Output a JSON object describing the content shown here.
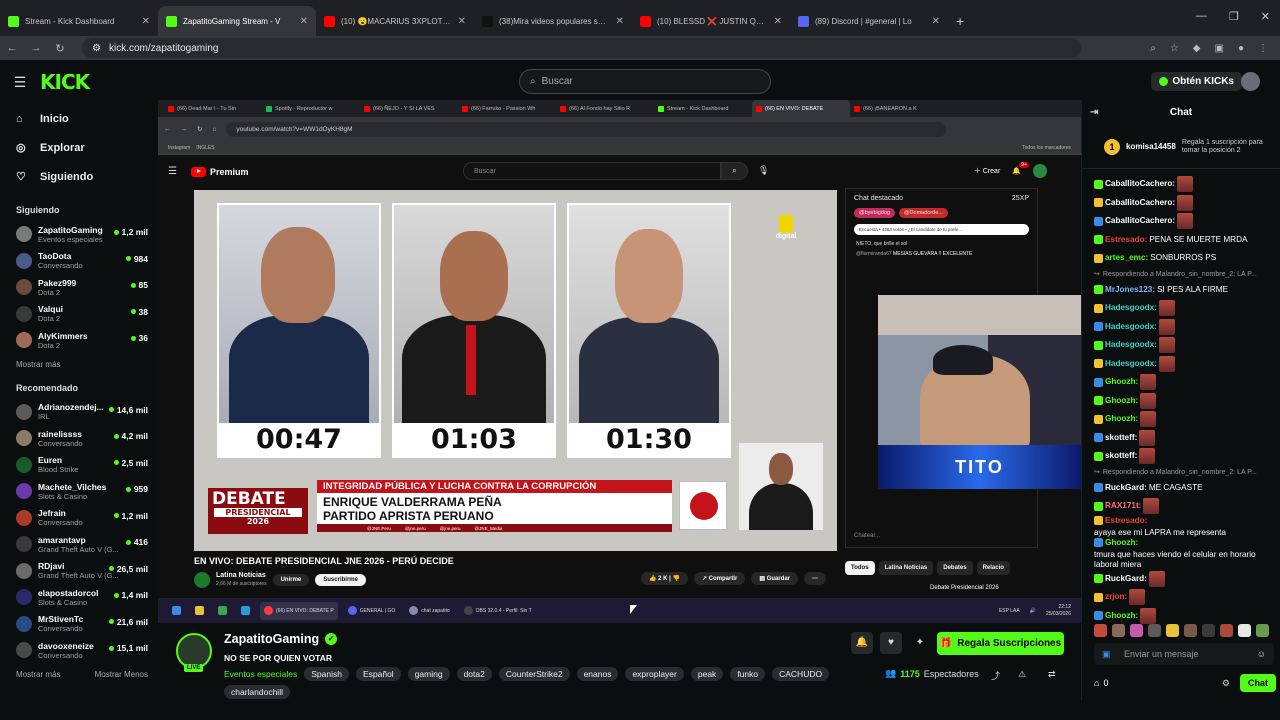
{
  "browser": {
    "tabs": [
      {
        "label": "Stream - Kick Dashboard",
        "color": "#53fc18",
        "active": false
      },
      {
        "label": "ZapatitoGaming Stream - V",
        "color": "#53fc18",
        "active": true
      },
      {
        "label": "(10) 😮MACARIUS 3XPLOTÓ y P",
        "color": "#ff0000",
        "active": false
      },
      {
        "label": "(38)Mira videos populares selec",
        "color": "#111111",
        "active": false
      },
      {
        "label": "(10) BLESSD ❌ JUSTIN QUILES",
        "color": "#ff0000",
        "active": false
      },
      {
        "label": "(89) Discord | #general | Lo",
        "color": "#5865f2",
        "active": false
      }
    ],
    "url": "kick.com/zapatitogaming"
  },
  "kick": {
    "logo": "KICK",
    "search_placeholder": "Buscar",
    "kicks_button": "Obtén KICKs"
  },
  "sidebar": {
    "nav": [
      {
        "label": "Inicio",
        "icon": "home-icon"
      },
      {
        "label": "Explorar",
        "icon": "compass-icon"
      },
      {
        "label": "Siguiendo",
        "icon": "heart-icon"
      }
    ],
    "following_title": "Siguiendo",
    "following": [
      {
        "name": "ZapatitoGaming",
        "game": "Eventos especiales",
        "viewers": "1,2 mil",
        "color": "#7a7a7a"
      },
      {
        "name": "TaoDota",
        "game": "Conversando",
        "viewers": "984",
        "color": "#4a5a8a"
      },
      {
        "name": "Pakez999",
        "game": "Dota 2",
        "viewers": "85",
        "color": "#6a4a3a"
      },
      {
        "name": "Valqui",
        "game": "Dota 2",
        "viewers": "38",
        "color": "#3a3a3a"
      },
      {
        "name": "AlyKimmers",
        "game": "Dota 2",
        "viewers": "36",
        "color": "#a06a5a"
      }
    ],
    "show_more": "Mostrar más",
    "recommended_title": "Recomendado",
    "recommended": [
      {
        "name": "Adrianozendej...",
        "game": "IRL",
        "viewers": "14,6 mil",
        "color": "#5a5a5a"
      },
      {
        "name": "rainelissss",
        "game": "Conversando",
        "viewers": "4,2 mil",
        "color": "#8a7a6a"
      },
      {
        "name": "Euren",
        "game": "Blood Strike",
        "viewers": "2,5 mil",
        "color": "#1a5a2a"
      },
      {
        "name": "Machete_Vilches",
        "game": "Slots & Casino",
        "viewers": "959",
        "color": "#6a3aaa"
      },
      {
        "name": "Jefrain",
        "game": "Conversando",
        "viewers": "1,2 mil",
        "color": "#aa3a2a"
      },
      {
        "name": "amarantavp",
        "game": "Grand Theft Auto V (G...",
        "viewers": "416",
        "color": "#3a3a3a"
      },
      {
        "name": "RDjavi",
        "game": "Grand Theft Auto V (G...",
        "viewers": "26,5 mil",
        "color": "#6a6a6a"
      },
      {
        "name": "elapostadorcol",
        "game": "Slots & Casino",
        "viewers": "1,4 mil",
        "color": "#2a2a6a"
      },
      {
        "name": "MrStivenTc",
        "game": "Conversando",
        "viewers": "21,6 mil",
        "color": "#2a4a8a"
      },
      {
        "name": "davooxeneize",
        "game": "Conversando",
        "viewers": "15,1 mil",
        "color": "#4a4a4a"
      }
    ],
    "show_more2": "Mostrar más",
    "show_less": "Mostrar Menos"
  },
  "inner_browser": {
    "tabs": [
      "(66) Dead Mar I - Tu Sin",
      "Spotify - Reproductor w",
      "(66) ÑEJO - Y SI LA VES",
      "(66) Farruko - Passion Wh",
      "(66) Al Fondo hay Sitio R",
      "Stream - Kick Dashboard",
      "(66) EN VIVO: DEBATE",
      "(66) ¡BANEARON a K"
    ],
    "url": "youtube.com/watch?v=WW1dOyKH8gM",
    "bookmarks": [
      "Instagram",
      "INGLES"
    ],
    "bookmarks_right": "Todos los marcadores"
  },
  "youtube": {
    "logo": "Premium",
    "search_placeholder": "Buscar",
    "create": "Crear",
    "notif_count": "9+",
    "timers": [
      "00:47",
      "01:03",
      "01:30"
    ],
    "digital": "digital",
    "debate_top": "DEBATE",
    "debate_sub": "PRESIDENCIAL",
    "debate_year": "2026",
    "lower_third_red": "INTEGRIDAD PÚBLICA Y LUCHA CONTRA LA CORRUPCIÓN",
    "lower_third_name": "ENRIQUE VALDERRAMA PEÑA",
    "lower_third_party": "PARTIDO APRISTA PERUANO",
    "handles": [
      "@JNE.Peru",
      "@jne.peru",
      "@jne.peru",
      "@JNE_Media"
    ],
    "video_title": "EN VIVO: DEBATE PRESIDENCIAL JNE 2026 - PERÚ DECIDE",
    "channel": "Latina Noticias",
    "subs": "2,66 M de suscriptores",
    "join": "Unirme",
    "subscribe": "Suscribirme",
    "likes": "2 K",
    "share": "Compartir",
    "save": "Guardar",
    "chat_title": "Chat destacado",
    "chat_poll": "Encuesta • 4353 votos • ¿El candidato de tu prefe...",
    "chat_line1": "NIETO, que brille el sol",
    "chat_user": "@flormiranda67",
    "chat_line2": "MESIAS GUEVARA !! EXCELENTE",
    "chat_placeholder": "Chatear...",
    "chips": [
      "Todos",
      "Latina Noticias",
      "Debates",
      "Relacio"
    ],
    "mentions": [
      "@byebigdog",
      "@Domadorde..."
    ],
    "chat_pin": "25XP",
    "rec_title": "Debate Presidencial 2026",
    "webcam_overlay": "TITO"
  },
  "taskbar": {
    "items": [
      "(66) EN VIVO: DEBATE P",
      "GENERAL | GO",
      "chat zapatito",
      "OBS 32.0.4 - Perfil: Sin T"
    ],
    "lang": "ESP LAA",
    "time": "22:12",
    "date": "25/03/2026"
  },
  "channel": {
    "name": "ZapatitoGaming",
    "live": "LIVE",
    "stream_title": "NO SE POR QUIEN VOTAR",
    "category": "Eventos especiales",
    "tags": [
      "Spanish",
      "Español",
      "gaming",
      "dota2",
      "CounterStrike2",
      "enanos",
      "exproplayer",
      "peak",
      "funko",
      "CACHUDO"
    ],
    "tag_extra": "charlandochill",
    "gift_button": "Regala Suscripciones",
    "viewers": "1175",
    "viewers_label": "Espectadores"
  },
  "chat": {
    "title": "Chat",
    "pinned_user": "komisa14458",
    "pinned_text": "Regala 1 suscripción para tomar la posición 2",
    "pinned_count": "1",
    "messages": [
      {
        "user": "CaballitoCachero:",
        "color": "#ffffff",
        "text": "",
        "emote": true
      },
      {
        "user": "CaballitoCachero:",
        "color": "#ffffff",
        "text": "",
        "emote": true
      },
      {
        "user": "CaballitoCachero:",
        "color": "#ffffff",
        "text": "",
        "emote": true
      },
      {
        "user": "Estresado:",
        "color": "#e8403c",
        "text": "PENA SE MUERTE MRDA",
        "emote": false
      },
      {
        "user": "artes_emc:",
        "color": "#53fc18",
        "text": "SONBURROS PS",
        "emote": false
      },
      {
        "reply": "Respondiendo a Malandro_sin_nombre_2: LA P..."
      },
      {
        "user": "MrJones123:",
        "color": "#7fb3ff",
        "text": "SI PES ALA FIRME",
        "emote": false
      },
      {
        "user": "Hadesgoodx:",
        "color": "#3fd2c6",
        "text": "",
        "emote": true
      },
      {
        "user": "Hadesgoodx:",
        "color": "#3fd2c6",
        "text": "",
        "emote": true
      },
      {
        "user": "Hadesgoodx:",
        "color": "#3fd2c6",
        "text": "",
        "emote": true
      },
      {
        "user": "Hadesgoodx:",
        "color": "#3fd2c6",
        "text": "",
        "emote": true
      },
      {
        "user": "Ghoozh:",
        "color": "#53fc18",
        "text": "",
        "emote": true
      },
      {
        "user": "Ghoozh:",
        "color": "#53fc18",
        "text": "",
        "emote": true
      },
      {
        "user": "Ghoozh:",
        "color": "#53fc18",
        "text": "",
        "emote": true
      },
      {
        "user": "skotteff:",
        "color": "#ffffff",
        "text": "",
        "emote": true
      },
      {
        "user": "skotteff:",
        "color": "#ffffff",
        "text": "",
        "emote": true
      },
      {
        "reply": "Respondiendo a Malandro_sin_nombre_2: LA P..."
      },
      {
        "user": "RuckGard:",
        "color": "#ffffff",
        "text": "ME CAGASTE",
        "emote": false
      },
      {
        "user": "RAX171t:",
        "color": "#ff7070",
        "text": "",
        "emote": true
      },
      {
        "user": "Estresado:",
        "color": "#e8403c",
        "text": "ayaya ese mi LAPRA me representa",
        "emote": false
      },
      {
        "user": "Ghoozh:",
        "color": "#53fc18",
        "text": "tmura que haces viendo el celular en horario laboral miera",
        "emote": false
      },
      {
        "user": "RuckGard:",
        "color": "#ffffff",
        "text": "",
        "emote": true
      },
      {
        "user": "zrjon:",
        "color": "#ff4040",
        "text": "",
        "emote": true
      },
      {
        "user": "Ghoozh:",
        "color": "#53fc18",
        "text": "",
        "emote": true
      }
    ],
    "send_placeholder": "Enviar un mensaje",
    "kicks_count": "0",
    "chat_button": "Chat"
  }
}
